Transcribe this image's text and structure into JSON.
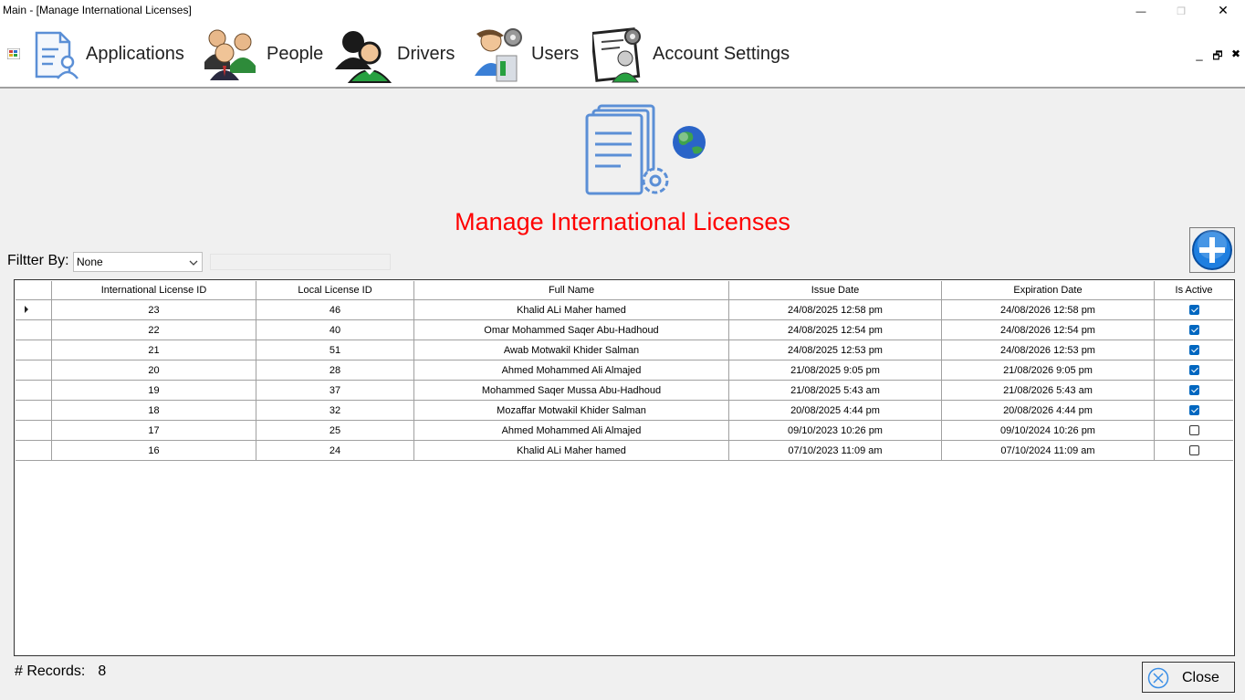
{
  "window": {
    "title": "Main - [Manage International Licenses]",
    "minimize_glyph": "—",
    "maximize_glyph": "❐",
    "close_glyph": "✕"
  },
  "menu": {
    "items": [
      {
        "label": "Applications",
        "icon": "applications-icon"
      },
      {
        "label": "People",
        "icon": "people-icon"
      },
      {
        "label": "Drivers",
        "icon": "drivers-icon"
      },
      {
        "label": "Users",
        "icon": "users-icon"
      },
      {
        "label": "Account Settings",
        "icon": "account-settings-icon"
      }
    ],
    "mdi_minimize": "_",
    "mdi_restore": "🗗",
    "mdi_close": "✖"
  },
  "page": {
    "heading": "Manage International Licenses",
    "heading_color": "#ff0000",
    "filter_label": "Filtter By:",
    "filter_value": "None",
    "records_label": "# Records:",
    "records_value": "8",
    "close_label": "Close"
  },
  "table": {
    "columns": [
      "International License ID",
      "Local License ID",
      "Full Name",
      "Issue Date",
      "Expiration Date",
      "Is Active"
    ],
    "rows": [
      {
        "intl_id": "23",
        "local_id": "46",
        "name": "Khalid ALi Maher hamed",
        "issue": "24/08/2025 12:58 pm",
        "expiration": "24/08/2026 12:58 pm",
        "active": true
      },
      {
        "intl_id": "22",
        "local_id": "40",
        "name": "Omar Mohammed Saqer Abu-Hadhoud",
        "issue": "24/08/2025 12:54 pm",
        "expiration": "24/08/2026 12:54 pm",
        "active": true
      },
      {
        "intl_id": "21",
        "local_id": "51",
        "name": "Awab Motwakil Khider Salman",
        "issue": "24/08/2025 12:53 pm",
        "expiration": "24/08/2026 12:53 pm",
        "active": true
      },
      {
        "intl_id": "20",
        "local_id": "28",
        "name": "Ahmed Mohammed Ali Almajed",
        "issue": "21/08/2025 9:05 pm",
        "expiration": "21/08/2026 9:05 pm",
        "active": true
      },
      {
        "intl_id": "19",
        "local_id": "37",
        "name": "Mohammed Saqer Mussa Abu-Hadhoud",
        "issue": "21/08/2025 5:43 am",
        "expiration": "21/08/2026 5:43 am",
        "active": true
      },
      {
        "intl_id": "18",
        "local_id": "32",
        "name": "Mozaffar Motwakil Khider Salman",
        "issue": "20/08/2025 4:44 pm",
        "expiration": "20/08/2026 4:44 pm",
        "active": true
      },
      {
        "intl_id": "17",
        "local_id": "25",
        "name": "Ahmed Mohammed Ali Almajed",
        "issue": "09/10/2023 10:26 pm",
        "expiration": "09/10/2024 10:26 pm",
        "active": false
      },
      {
        "intl_id": "16",
        "local_id": "24",
        "name": "Khalid ALi Maher hamed",
        "issue": "07/10/2023 11:09 am",
        "expiration": "07/10/2024 11:09 am",
        "active": false
      }
    ]
  },
  "colors": {
    "accent_blue": "#0067c0",
    "doc_icon_blue": "#5b8fd6"
  }
}
